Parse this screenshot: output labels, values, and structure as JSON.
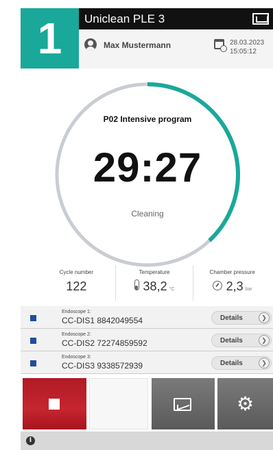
{
  "header": {
    "station_number": "1",
    "device_title": "Uniclean PLE 3",
    "user_name": "Max Mustermann",
    "date": "28.03.2023",
    "time": "15:05:12"
  },
  "program": {
    "name": "P02 Intensive program",
    "remaining_time": "29:27",
    "phase": "Cleaning",
    "progress_fraction": 0.38
  },
  "stats": {
    "cycle": {
      "label": "Cycle number",
      "value": "122"
    },
    "temperature": {
      "label": "Temperature",
      "value": "38,2",
      "unit": "°C"
    },
    "pressure": {
      "label": "Chamber pressure",
      "value": "2,3",
      "unit": "bar"
    }
  },
  "endoscopes": [
    {
      "label": "Endoscope 1:",
      "id": "CC-DIS1 8842049554",
      "button": "Details"
    },
    {
      "label": "Endoscope 2:",
      "id": "CC-DIS2 72274859592",
      "button": "Details"
    },
    {
      "label": "Endoscope 3:",
      "id": "CC-DIS3 9338572939",
      "button": "Details"
    }
  ],
  "colors": {
    "accent": "#1aa89a",
    "ring_track": "#c9cdd3",
    "stop": "#c62630",
    "endoscope_marker": "#1d4ea0"
  },
  "icons": {
    "stop": "stop-square-icon",
    "chart": "chart-icon",
    "settings": "gear-icon",
    "info": "info-icon"
  }
}
